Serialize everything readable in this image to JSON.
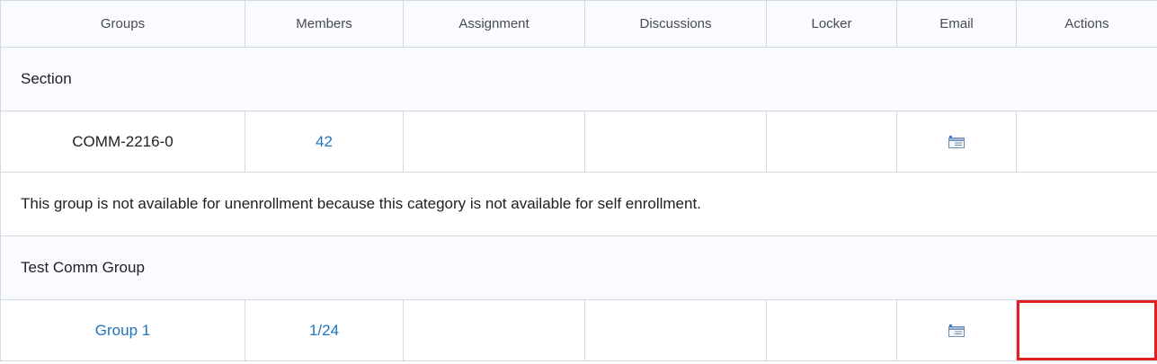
{
  "columns": [
    "Groups",
    "Members",
    "Assignment",
    "Discussions",
    "Locker",
    "Email",
    "Actions"
  ],
  "sections": [
    {
      "category": "Section",
      "rows": [
        {
          "group": "COMM-2216-0",
          "group_is_link": false,
          "members": "42",
          "email_icon": "email-icon"
        }
      ],
      "notice": "This group is not available for unenrollment because this category is not available for self enrollment."
    },
    {
      "category": "Test Comm Group",
      "rows": [
        {
          "group": "Group 1",
          "group_is_link": true,
          "members": "1/24",
          "email_icon": "email-icon"
        }
      ]
    }
  ],
  "colors": {
    "link": "#1e73be",
    "header_bg": "#f9fbff",
    "border": "#d3d9e3",
    "highlight": "#e0201f"
  }
}
